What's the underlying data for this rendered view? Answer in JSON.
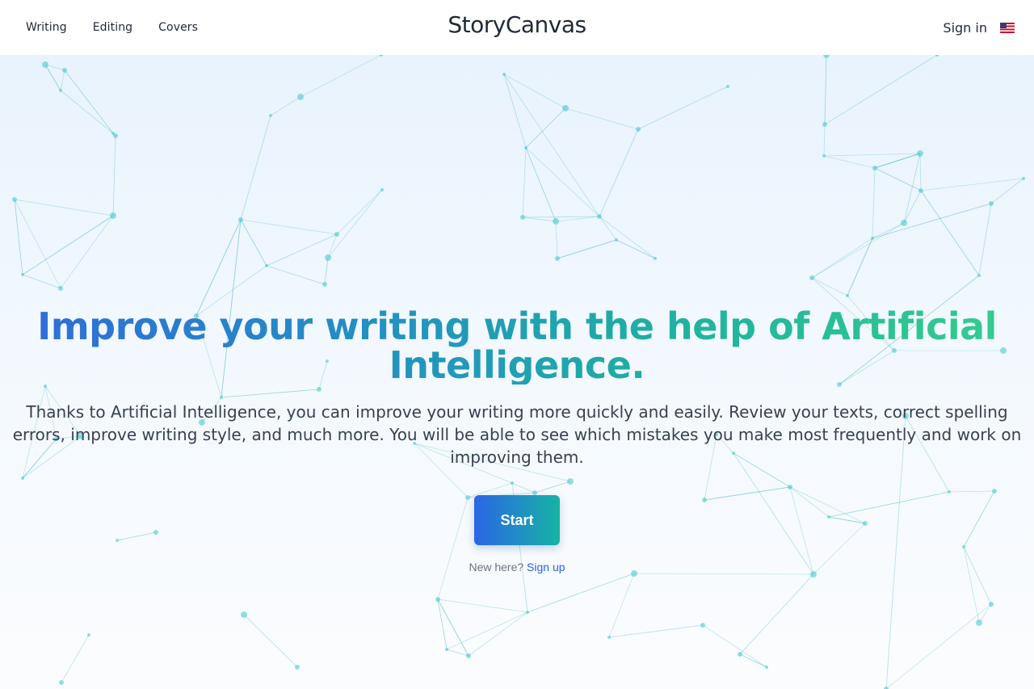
{
  "nav": {
    "items": [
      {
        "label": "Writing"
      },
      {
        "label": "Editing"
      },
      {
        "label": "Covers"
      }
    ],
    "brand": "StoryCanvas",
    "sign_in": "Sign in",
    "language_flag_icon": "us-flag-icon"
  },
  "hero": {
    "headline": "Improve your writing with the help of Artificial Intelligence.",
    "subtext": "Thanks to Artificial Intelligence, you can improve your writing more quickly and easily. Review your texts, correct spelling errors, improve writing style, and much more. You will be able to see which mistakes you make most frequently and work on improving them.",
    "start_label": "Start",
    "signup_prompt": "New here?",
    "signup_link": "Sign up"
  },
  "colors": {
    "text": "#1f2937",
    "gradient_start": "#2b66e6",
    "gradient_end": "#33cc8f",
    "link": "#2563eb",
    "network_line": "#4fb6c8",
    "network_node": "#3cc6cc"
  }
}
